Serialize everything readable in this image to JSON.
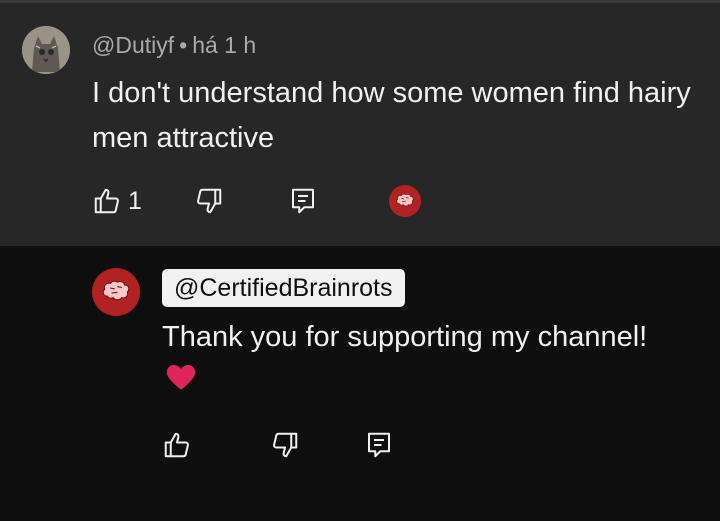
{
  "comment": {
    "author": "@Dutiyf",
    "separator": "•",
    "time": "há 1 h",
    "text": "I don't understand how some women find hairy men attractive",
    "like_count": "1"
  },
  "reply": {
    "author": "@CertifiedBrainrots",
    "text": "Thank you for supporting my channel!",
    "emoji": "❤️"
  },
  "colors": {
    "top_background": "#272727",
    "page_background": "#0f0f0f",
    "avatar_red": "#b32222",
    "heart": "#e0245e"
  },
  "icons": {
    "like": "thumbs-up-icon",
    "dislike": "thumbs-down-icon",
    "reply": "reply-comment-icon",
    "brain": "brain-icon"
  }
}
